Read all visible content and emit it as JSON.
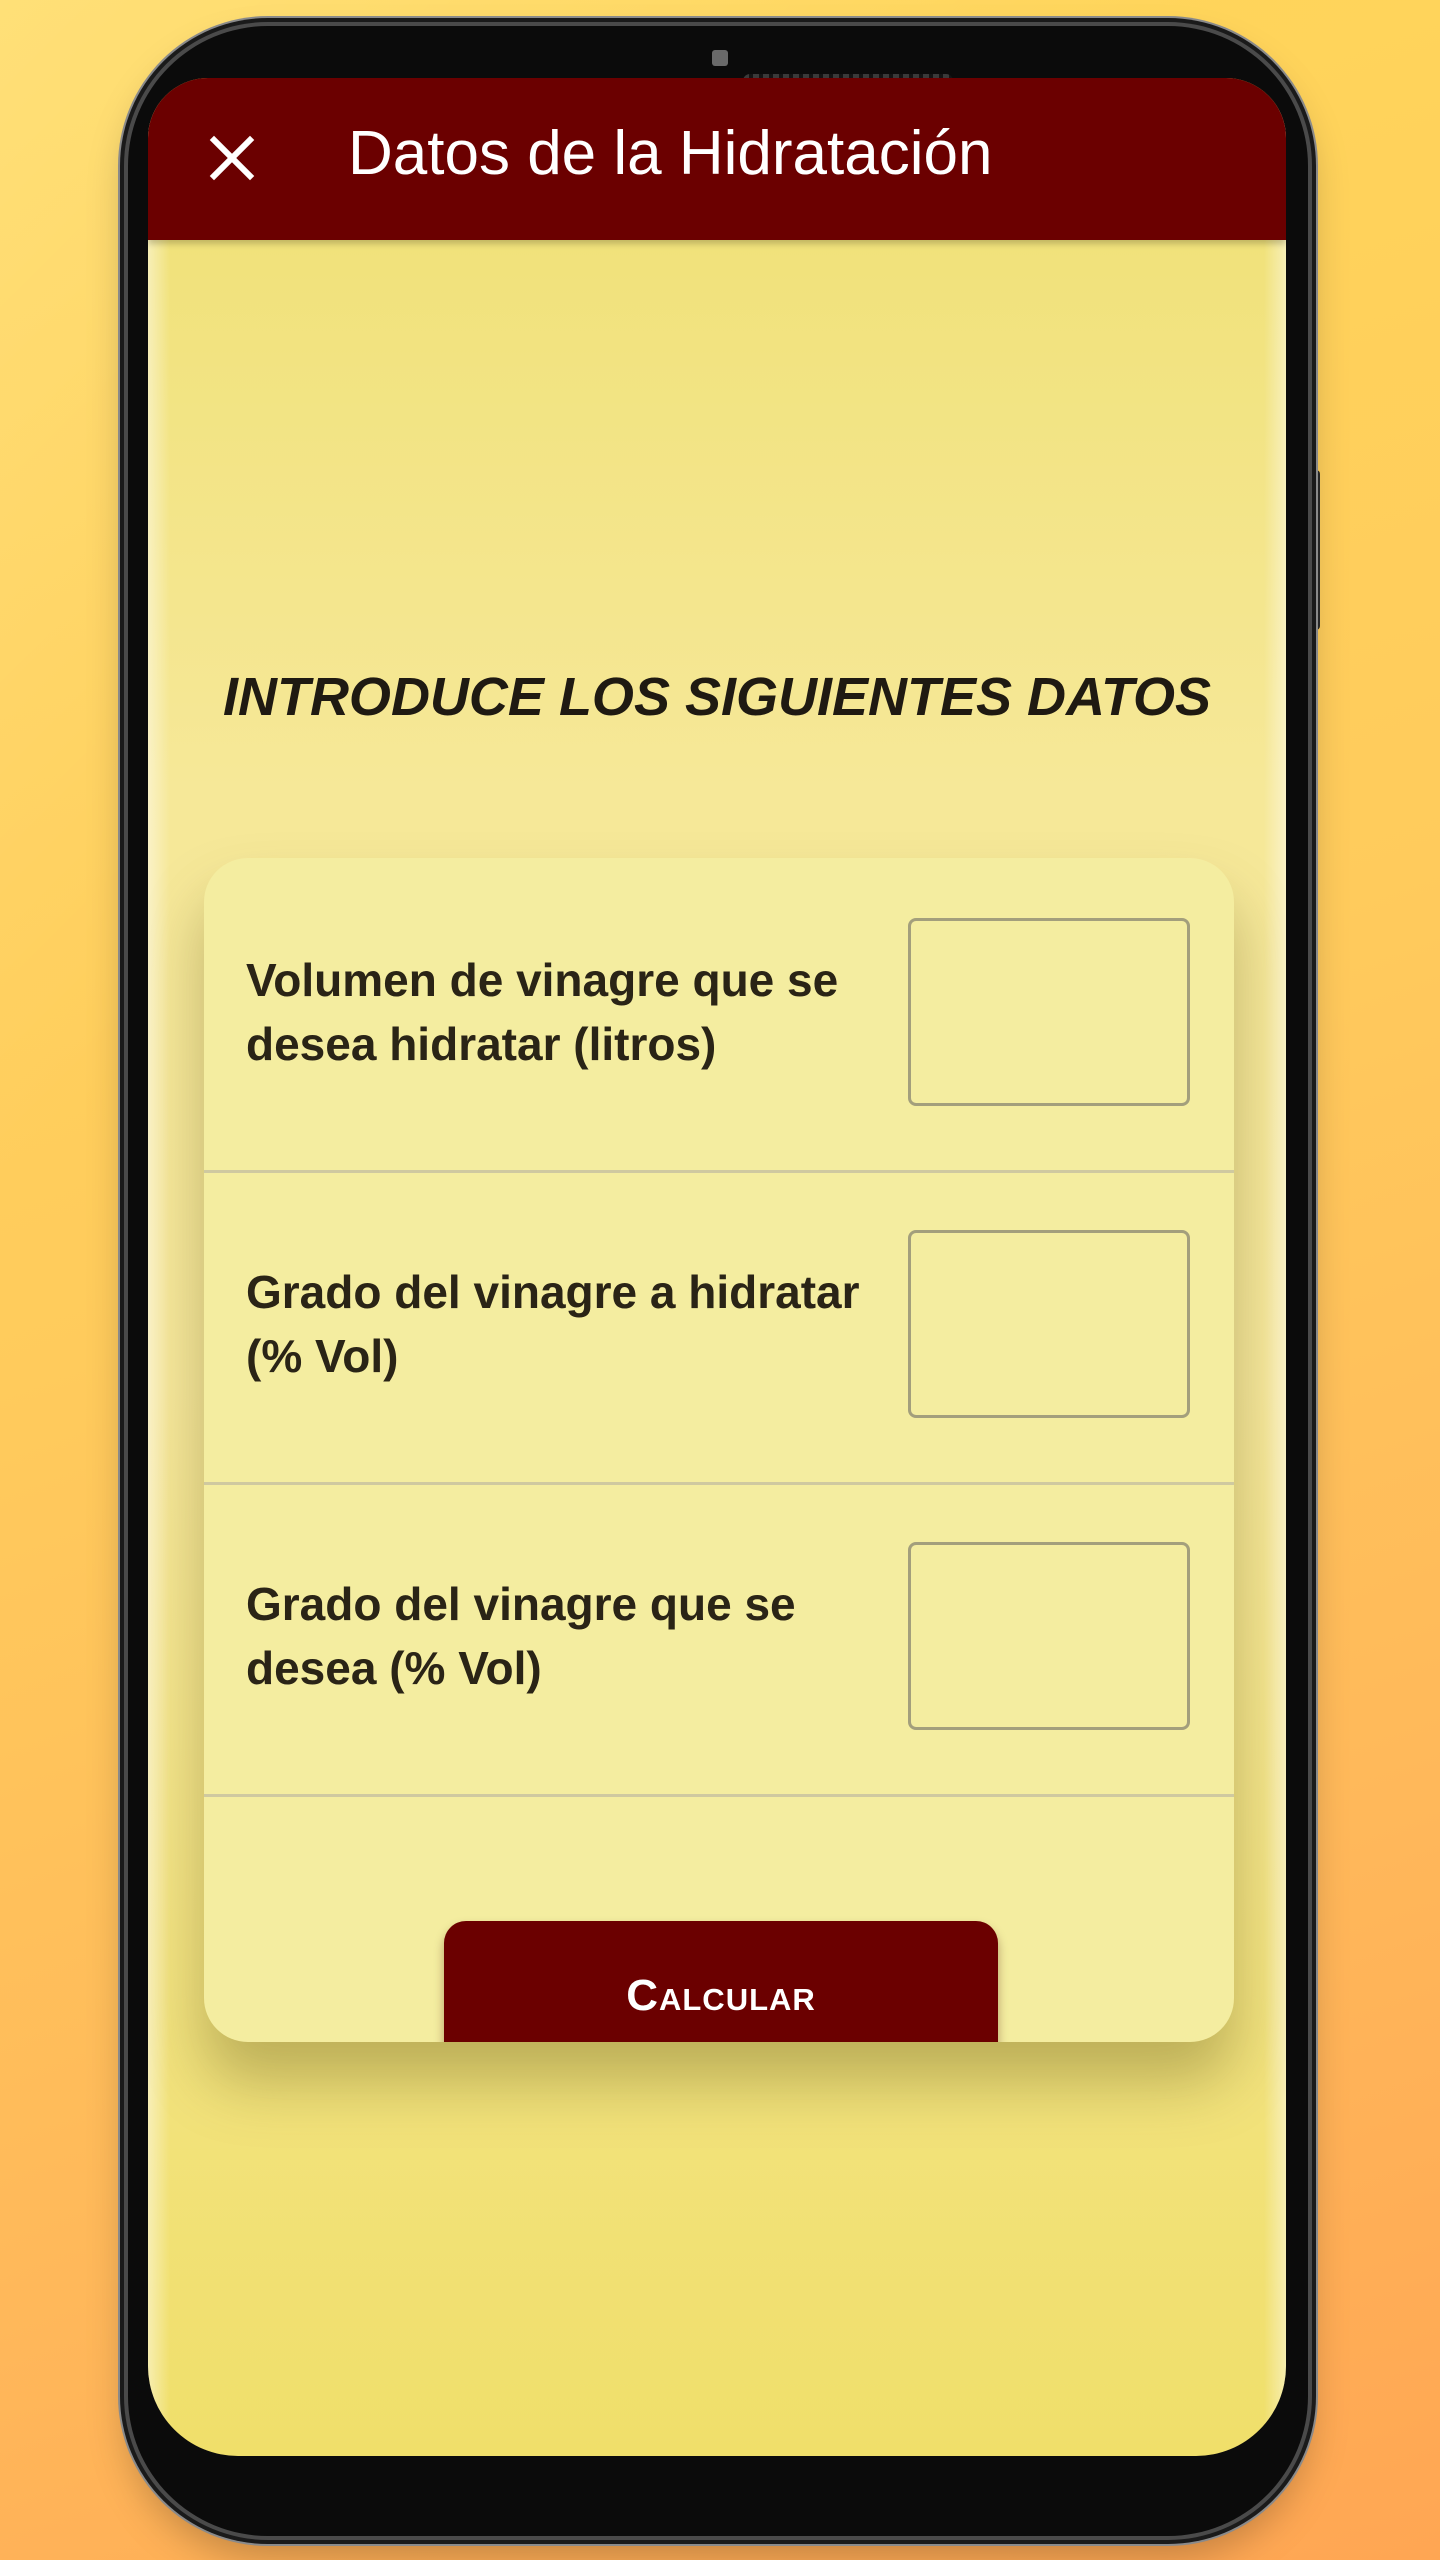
{
  "appbar": {
    "title": "Datos de la Hidratación",
    "close_icon": "close-icon",
    "background_color": "#6b0000"
  },
  "main": {
    "heading": "INTRODUCE LOS SIGUIENTES DATOS"
  },
  "form": {
    "fields": [
      {
        "label": "Volumen de vinagre que se desea hidratar (litros)",
        "value": "",
        "placeholder": ""
      },
      {
        "label": "Grado del vinagre a hidratar (% Vol)",
        "value": "",
        "placeholder": ""
      },
      {
        "label": "Grado del vinagre que se desea (% Vol)",
        "value": "",
        "placeholder": ""
      }
    ],
    "submit_label": "Calcular"
  },
  "colors": {
    "accent": "#6b0000",
    "card": "#f4eda0",
    "screen": "#f6e898"
  }
}
